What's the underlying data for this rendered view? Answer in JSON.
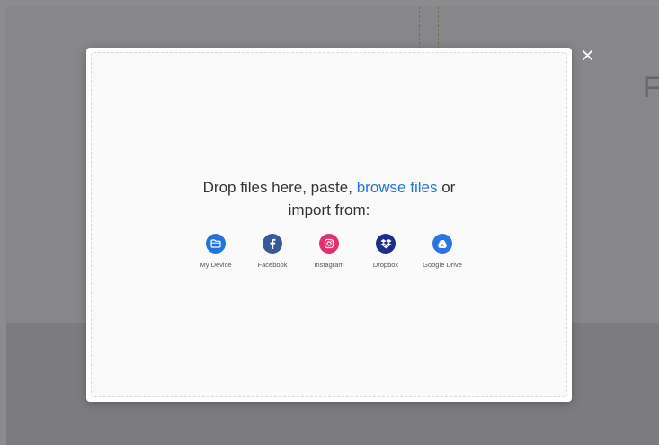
{
  "background": {
    "partial_heading": "F"
  },
  "modal": {
    "close_label": "×",
    "drop_text_prefix": "Drop files here, paste,",
    "browse_link": "browse files",
    "drop_text_suffix": "or",
    "drop_text_line2": "import from:",
    "providers": [
      {
        "label": "My Device",
        "icon": "folder-icon",
        "color": "#2275d7"
      },
      {
        "label": "Facebook",
        "icon": "facebook-icon",
        "color": "#3a5998"
      },
      {
        "label": "Instagram",
        "icon": "instagram-icon",
        "color": "#e1306c"
      },
      {
        "label": "Dropbox",
        "icon": "dropbox-icon",
        "color": "#1f2f86"
      },
      {
        "label": "Google Drive",
        "icon": "google-drive-icon",
        "color": "#2c74e0"
      }
    ]
  },
  "colors": {
    "accent": "#2275d7",
    "overlay": "#464448"
  }
}
